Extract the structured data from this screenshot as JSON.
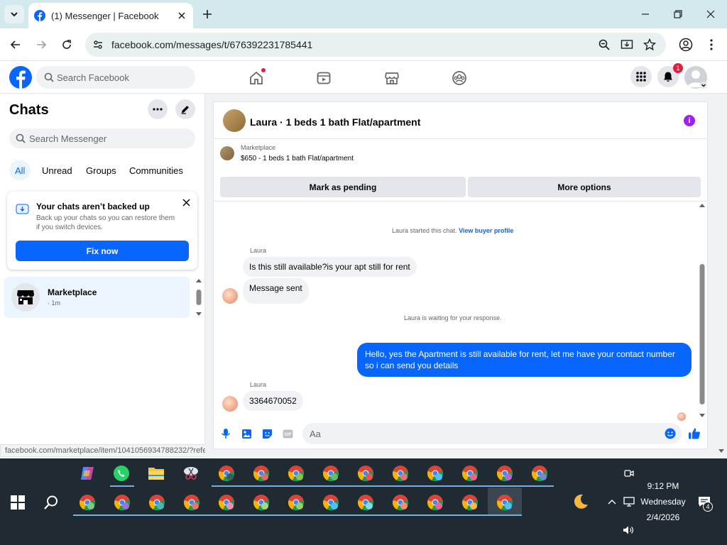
{
  "browser": {
    "tab_title": "(1) Messenger | Facebook",
    "url": "facebook.com/messages/t/676392231785441",
    "status_url": "facebook.com/marketplace/item/1041056934788232/?referr..."
  },
  "fb": {
    "search_placeholder": "Search Facebook",
    "notification_count": "1"
  },
  "chats": {
    "heading": "Chats",
    "search_placeholder": "Search Messenger",
    "filters": [
      "All",
      "Unread",
      "Groups",
      "Communities"
    ],
    "backup_title": "Your chats aren’t backed up",
    "backup_desc": "Back up your chats so you can restore them if you switch devices.",
    "fix_label": "Fix now",
    "items": [
      {
        "name": "Marketplace",
        "time": "· 1m"
      }
    ]
  },
  "conversation": {
    "title": "Laura · 1 beds 1 bath Flat/apartment",
    "listing_source": "Marketplace",
    "listing_price": "$650 - 1 beds 1 bath Flat/apartment",
    "mark_pending": "Mark as pending",
    "more_options": "More options",
    "started_text": "Laura started this chat.",
    "view_profile": "View buyer profile",
    "sender_name": "Laura",
    "msg1": "Is this still available?is your apt still for rent",
    "msg2": "Message sent",
    "waiting_text": "Laura is waiting for your response.",
    "reply": "Hello, yes the Apartment is still available for rent, let me have your contact number so i can send you details",
    "sender_name_2": "Laura",
    "msg3": "3364670052",
    "composer_placeholder": "Aa"
  },
  "taskbar": {
    "time": "9:12 PM",
    "day": "Wednesday",
    "date": "2/4/2026",
    "notification_count": "4"
  },
  "colors": {
    "fb_blue": "#0866ff",
    "taskbar": "#202a33",
    "tabstrip": "#d4e9ee"
  }
}
